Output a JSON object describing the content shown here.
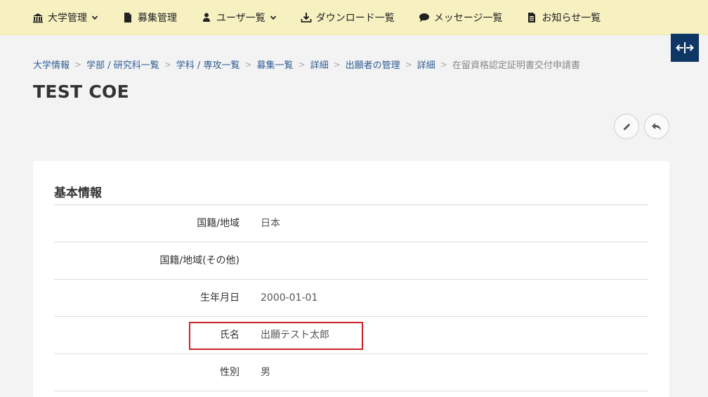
{
  "nav": {
    "items": [
      {
        "label": "大学管理",
        "icon": "university-icon",
        "dropdown": true
      },
      {
        "label": "募集管理",
        "icon": "file-icon",
        "dropdown": false
      },
      {
        "label": "ユーザ一覧",
        "icon": "user-icon",
        "dropdown": true
      },
      {
        "label": "ダウンロード一覧",
        "icon": "download-icon",
        "dropdown": false
      },
      {
        "label": "メッセージ一覧",
        "icon": "message-icon",
        "dropdown": false
      },
      {
        "label": "お知らせ一覧",
        "icon": "notice-icon",
        "dropdown": false
      }
    ]
  },
  "breadcrumb": [
    "大学情報",
    "学部 / 研究科一覧",
    "学科 / 専攻一覧",
    "募集一覧",
    "詳細",
    "出願者の管理",
    "詳細",
    "在留資格認定証明書交付申請書"
  ],
  "breadcrumb_separator": ">",
  "page": {
    "title": "TEST COE"
  },
  "actions": {
    "edit_icon": "pencil-icon",
    "back_icon": "reply-icon"
  },
  "section": {
    "title": "基本情報",
    "rows": [
      {
        "label": "国籍/地域",
        "value": "日本"
      },
      {
        "label": "国籍/地域(その他)",
        "value": ""
      },
      {
        "label": "生年月日",
        "value": "2000-01-01"
      },
      {
        "label": "氏名",
        "value": "出願テスト太郎"
      },
      {
        "label": "性別",
        "value": "男"
      }
    ]
  },
  "colors": {
    "nav_bg": "#f7f1c2",
    "accent": "#0f3765",
    "link": "#2d5c93",
    "highlight": "#cc2222"
  }
}
